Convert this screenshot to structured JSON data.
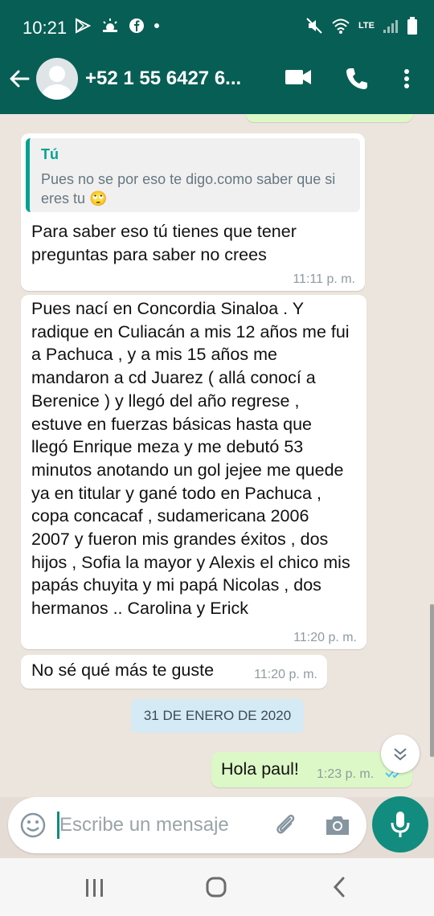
{
  "status_bar": {
    "time": "10:21",
    "network": "LTE"
  },
  "header": {
    "contact": "+52 1 55 6427 6..."
  },
  "messages": [
    {
      "quote_author": "Tú",
      "quote_text": "Pues no se por eso te digo.como saber que si eres tu 🙄",
      "text": "Para saber eso tú tienes que tener preguntas para saber no crees",
      "time": "11:11 p. m."
    },
    {
      "text": "Pues nací en Concordia Sinaloa . Y radique en Culiacán a mis 12 años me fui a Pachuca , y a mis 15 años me mandaron a cd Juarez ( allá conocí a Berenice ) y llegó del año regrese , estuve en fuerzas básicas hasta que llegó Enrique meza y me debutó  53 minutos anotando un gol jejee me quede ya en titular y gané todo en Pachuca , copa concacaf , sudamericana 2006 2007 y fueron mis grandes éxitos , dos hijos , Sofia la mayor y Alexis el chico mis papás chuyita y mi papá Nicolas , dos hermanos .. Carolina y Erick",
      "time": "11:20 p. m."
    },
    {
      "text": "No sé qué más te guste",
      "time": "11:20 p. m."
    }
  ],
  "date_divider": "31 DE ENERO DE 2020",
  "outgoing": {
    "text": "Hola paul!",
    "time": "1:23 p. m."
  },
  "input": {
    "placeholder": "Escribe un mensaje"
  },
  "colors": {
    "header": "#075e54",
    "accent": "#128c7e",
    "bubble_out": "#dcf8c6",
    "bubble_in": "#ffffff",
    "chip": "#d4eaf4"
  }
}
